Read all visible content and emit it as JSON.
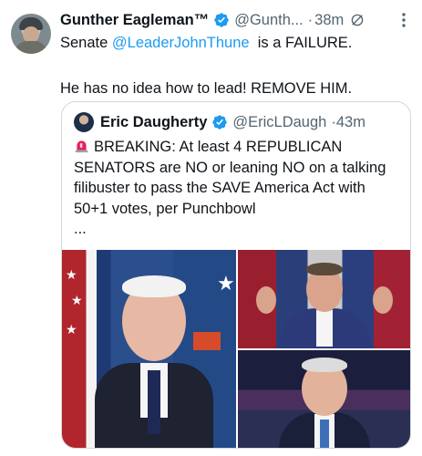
{
  "post": {
    "author_name": "Gunther Eagleman™",
    "author_handle": "@Gunth...",
    "separator": "·",
    "time": "38m",
    "lines": [
      {
        "pre": "Senate ",
        "mention": "@LeaderJohnThune",
        "post": "  is a FAILURE."
      },
      {
        "text": "He has no idea how to lead!  REMOVE HIM."
      }
    ]
  },
  "quote": {
    "author_name": "Eric Daugherty",
    "author_handle": "@EricLDaugh",
    "separator": "·",
    "time": "43m",
    "lines": [
      "BREAKING: At least 4 REPUBLICAN",
      "SENATORS are NO or leaning NO on a talking",
      "filibuster to pass the SAVE America Act with",
      "50+1 votes, per Punchbowl"
    ],
    "ellipsis": "...",
    "media": [
      "photo-senator-portrait",
      "photo-senator-speaking",
      "photo-senator-podium"
    ]
  },
  "icons": {
    "verified": "verified-badge-icon",
    "edit": "edited-icon",
    "more": "more-options-icon",
    "siren": "rotating-light-icon"
  },
  "colors": {
    "accent": "#1d9bf0",
    "secondary_text": "#536471",
    "border": "#cfd9de"
  }
}
